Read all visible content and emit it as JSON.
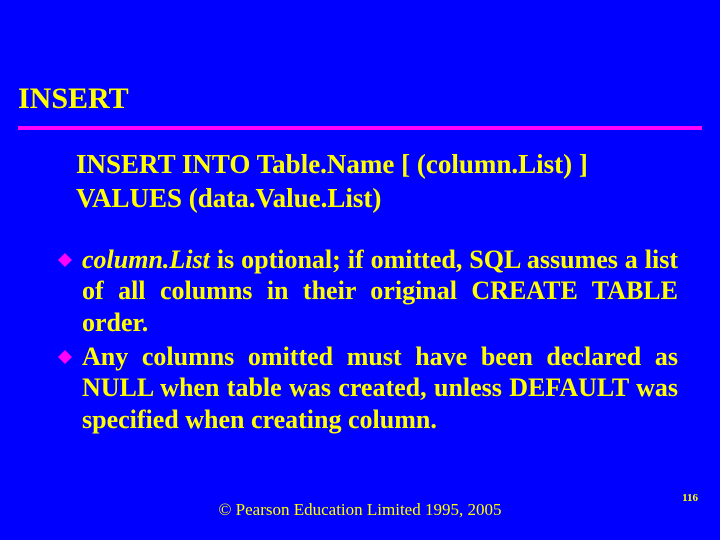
{
  "title": "INSERT",
  "syntax": {
    "line1": "INSERT INTO Table.Name [ (column.List) ]",
    "line2": "VALUES (data.Value.List)"
  },
  "bullets": [
    {
      "italic_prefix": "column.List",
      "rest": " is optional; if omitted, SQL assumes a list of all columns in their original CREATE TABLE order."
    },
    {
      "italic_prefix": "",
      "rest": "Any columns omitted must have been declared as NULL when table was created, unless DEFAULT was specified when creating column."
    }
  ],
  "footer": "© Pearson Education Limited 1995, 2005",
  "page_number": "116",
  "colors": {
    "bg": "#0000ff",
    "fg": "#ffff00",
    "rule": "#ff00ff",
    "diamond": "#ff00ff"
  }
}
